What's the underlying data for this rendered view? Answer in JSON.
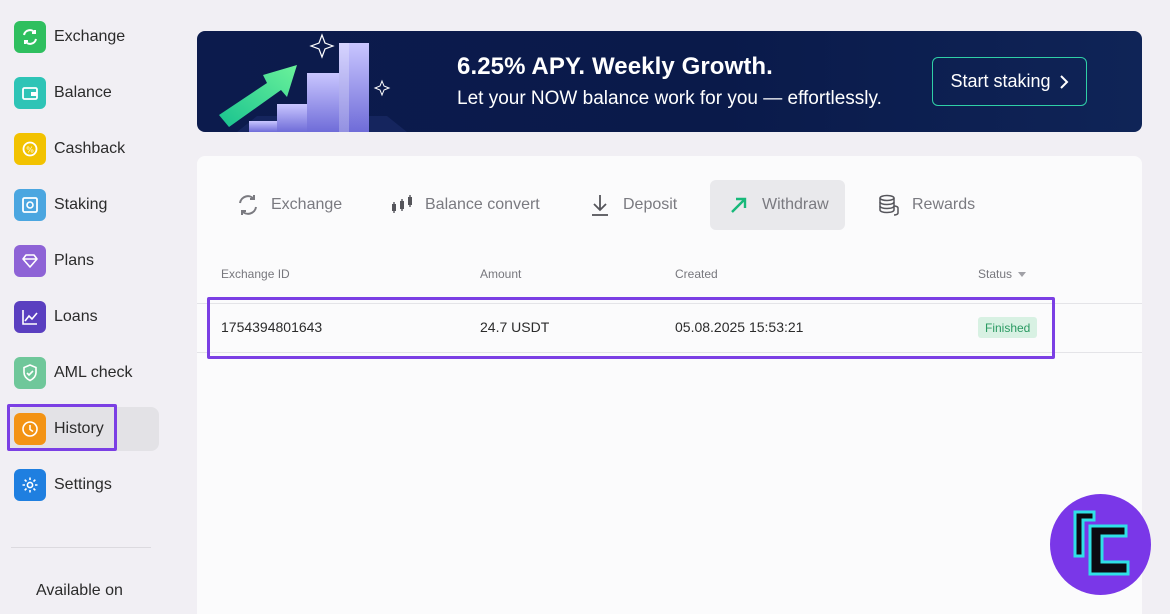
{
  "sidebar": {
    "items": [
      {
        "label": "Exchange",
        "icon": "exchange-icon",
        "color": "#2fbf5f"
      },
      {
        "label": "Balance",
        "icon": "wallet-icon",
        "color": "#2ec4b6"
      },
      {
        "label": "Cashback",
        "icon": "cashback-icon",
        "color": "#f2c200"
      },
      {
        "label": "Staking",
        "icon": "safe-icon",
        "color": "#4ba6e0"
      },
      {
        "label": "Plans",
        "icon": "diamond-icon",
        "color": "#8e63d6"
      },
      {
        "label": "Loans",
        "icon": "chart-icon",
        "color": "#5a3fc0"
      },
      {
        "label": "AML check",
        "icon": "shield-icon",
        "color": "#6fc79a"
      },
      {
        "label": "History",
        "icon": "clock-icon",
        "color": "#f39314"
      },
      {
        "label": "Settings",
        "icon": "gear-icon",
        "color": "#1f7fe0"
      }
    ],
    "active": "History",
    "available_label": "Available on"
  },
  "banner": {
    "title": "6.25% APY. Weekly Growth.",
    "subtitle": "Let your NOW balance work for you — effortlessly.",
    "button_label": "Start staking"
  },
  "tabs": [
    {
      "label": "Exchange",
      "icon": "exchange-arrows-icon"
    },
    {
      "label": "Balance convert",
      "icon": "candlestick-icon"
    },
    {
      "label": "Deposit",
      "icon": "download-icon"
    },
    {
      "label": "Withdraw",
      "icon": "arrow-up-right-icon",
      "active": true
    },
    {
      "label": "Rewards",
      "icon": "coins-icon"
    }
  ],
  "table": {
    "columns": [
      "Exchange ID",
      "Amount",
      "Created",
      "Status"
    ],
    "rows": [
      {
        "id": "1754394801643",
        "amount": "24.7 USDT",
        "created": "05.08.2025 15:53:21",
        "status": "Finished"
      }
    ]
  },
  "colors": {
    "highlight": "#7b3fe4",
    "accent_green": "#2fcfa6",
    "banner_bg": "#0c1b4d",
    "status_finished": "#2a9a62"
  }
}
